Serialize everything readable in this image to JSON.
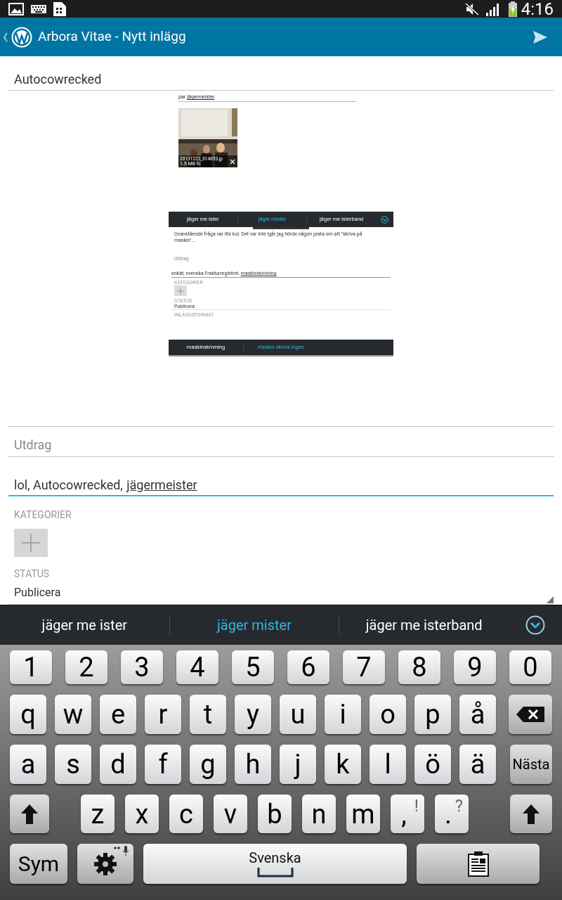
{
  "status_bar": {
    "time": "4:16"
  },
  "action_bar": {
    "title": "Arbora Vitae - Nytt inlägg"
  },
  "post": {
    "title": "Autocowrecked",
    "content_images": [
      {
        "kind": "attachment_shot",
        "line_text": "par",
        "line_composing": "jägermeister",
        "attachment": {
          "kind": "picture",
          "filename": "20131223_014853.jp",
          "size": "1.5 MB fil"
        }
      },
      {
        "kind": "editor_shot",
        "suggestions": [
          {
            "text": "jäger me ister",
            "selected": false
          },
          {
            "text": "jäger mister",
            "selected": true
          },
          {
            "text": "jäger me isterband",
            "selected": false
          }
        ],
        "body": "Ovanstående fråga var lite kul. Det var inte igår jag hörde någon prata om att \"skriva på maskin\"...",
        "excerpt_placeholder": "Utdrag",
        "tags": "enkät, svenska Frakturregistret,",
        "tags_composing": "maskinskrivning",
        "categories_label": "KATEGORIER",
        "status_label": "STATUS",
        "status": "Publicera",
        "format_label": "INLÄGGSFORMAT",
        "bottom_suggestions": [
          {
            "text": "maskinskrivning",
            "selected": false
          },
          {
            "text": "maskin skriva ingen",
            "selected": true
          }
        ]
      }
    ],
    "excerpt_placeholder": "Utdrag",
    "tags": "lol, Autocowrecked,",
    "tags_composing": "jägermeister",
    "categories_label": "KATEGORIER",
    "status_label": "STATUS",
    "status": "Publicera"
  },
  "suggestions": [
    {
      "text": "jäger me ister",
      "selected": false
    },
    {
      "text": "jäger mister",
      "selected": true
    },
    {
      "text": "jäger me isterband",
      "selected": false
    }
  ],
  "keyboard": {
    "rows": [
      {
        "keys": [
          {
            "kind": "char",
            "label": "1"
          },
          {
            "kind": "char",
            "label": "2"
          },
          {
            "kind": "char",
            "label": "3"
          },
          {
            "kind": "char",
            "label": "4"
          },
          {
            "kind": "char",
            "label": "5"
          },
          {
            "kind": "char",
            "label": "6"
          },
          {
            "kind": "char",
            "label": "7"
          },
          {
            "kind": "char",
            "label": "8"
          },
          {
            "kind": "char",
            "label": "9"
          },
          {
            "kind": "char",
            "label": "0"
          }
        ]
      },
      {
        "keys": [
          {
            "kind": "char",
            "label": "q"
          },
          {
            "kind": "char",
            "label": "w"
          },
          {
            "kind": "char",
            "label": "e"
          },
          {
            "kind": "char",
            "label": "r"
          },
          {
            "kind": "char",
            "label": "t"
          },
          {
            "kind": "char",
            "label": "y"
          },
          {
            "kind": "char",
            "label": "u"
          },
          {
            "kind": "char",
            "label": "i"
          },
          {
            "kind": "char",
            "label": "o"
          },
          {
            "kind": "char",
            "label": "p"
          },
          {
            "kind": "char",
            "label": "å"
          },
          {
            "kind": "backspace"
          }
        ]
      },
      {
        "keys": [
          {
            "kind": "char",
            "label": "a"
          },
          {
            "kind": "char",
            "label": "s"
          },
          {
            "kind": "char",
            "label": "d"
          },
          {
            "kind": "char",
            "label": "f"
          },
          {
            "kind": "char",
            "label": "g"
          },
          {
            "kind": "char",
            "label": "h"
          },
          {
            "kind": "char",
            "label": "j"
          },
          {
            "kind": "char",
            "label": "k"
          },
          {
            "kind": "char",
            "label": "l"
          },
          {
            "kind": "char",
            "label": "ö"
          },
          {
            "kind": "char",
            "label": "ä"
          },
          {
            "kind": "action",
            "label": "Nästa"
          }
        ]
      },
      {
        "keys": [
          {
            "kind": "shift"
          },
          {
            "kind": "char",
            "label": "z"
          },
          {
            "kind": "char",
            "label": "x"
          },
          {
            "kind": "char",
            "label": "c"
          },
          {
            "kind": "char",
            "label": "v"
          },
          {
            "kind": "char",
            "label": "b"
          },
          {
            "kind": "char",
            "label": "n"
          },
          {
            "kind": "char",
            "label": "m"
          },
          {
            "kind": "char",
            "label": ",",
            "alt": "!"
          },
          {
            "kind": "char",
            "label": ".",
            "alt": "?"
          },
          {
            "kind": "shift"
          }
        ]
      },
      {
        "keys": [
          {
            "kind": "action",
            "label": "Sym"
          },
          {
            "kind": "settings"
          },
          {
            "kind": "space",
            "label": "Svenska"
          },
          {
            "kind": "clipboard"
          }
        ]
      }
    ]
  }
}
